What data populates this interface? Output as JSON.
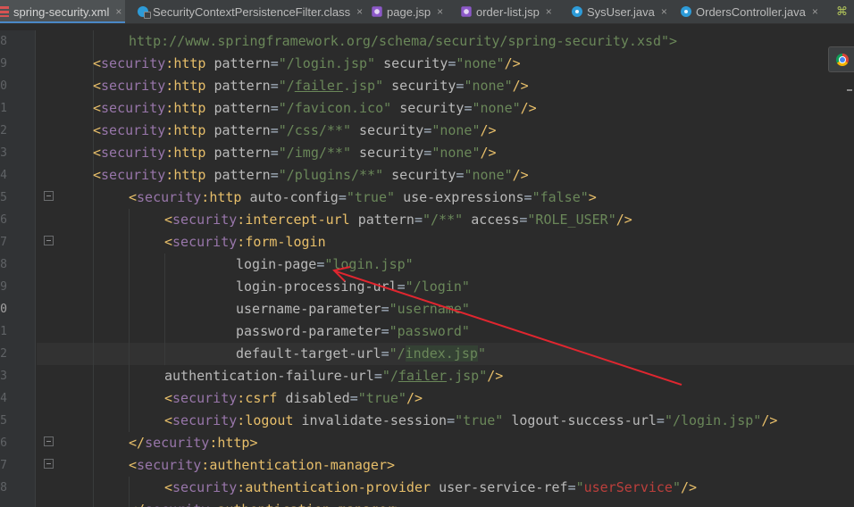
{
  "tabs": [
    {
      "label": "spring-security.xml",
      "icon": "xml-file-icon",
      "active": true
    },
    {
      "label": "SecurityContextPersistenceFilter.class",
      "icon": "class-file-icon",
      "active": false
    },
    {
      "label": "page.jsp",
      "icon": "jsp-file-icon",
      "active": false
    },
    {
      "label": "order-list.jsp",
      "icon": "jsp-file-icon",
      "active": false
    },
    {
      "label": "SysUser.java",
      "icon": "java-file-icon",
      "active": false
    },
    {
      "label": "OrdersController.java",
      "icon": "java-file-icon",
      "active": false
    }
  ],
  "tab_close_glyph": "×",
  "line_numbers": [
    "8",
    "9",
    "0",
    "1",
    "2",
    "3",
    "4",
    "5",
    "6",
    "7",
    "8",
    "9",
    "0",
    "1",
    "2",
    "3",
    "4",
    "5",
    "6",
    "7",
    "8"
  ],
  "current_line_index": 12,
  "code": {
    "l8_url": "http://www.springframework.org/schema/security/spring-security.xsd\">",
    "ns": "security",
    "http": "http",
    "pattern_attr": "pattern",
    "security_attr": "security",
    "none": "\"none\"",
    "patterns": [
      "\"/login.jsp\"",
      "\"/",
      "\"/favicon.ico\"",
      "\"/css/**\"",
      "\"/img/**\"",
      "\"/plugins/**\""
    ],
    "failer_name": "failer",
    "failer_ext": ".jsp\"",
    "auto_config_attr": "auto-config",
    "auto_config_val": "\"true\"",
    "use_expr_attr": "use-expressions",
    "use_expr_val": "\"false\"",
    "intercept_url": "intercept-url",
    "intercept_pattern": "\"/**\"",
    "access_attr": "access",
    "access_val": "\"ROLE_USER\"",
    "form_login": "form-login",
    "login_page_attr": "login-page",
    "login_page_val": "\"login.jsp\"",
    "login_proc_attr": "login-processing-url",
    "login_proc_val": "\"/login\"",
    "username_attr": "username-parameter",
    "username_val": "\"username\"",
    "password_attr": "password-parameter",
    "password_val": "\"password\"",
    "default_target_attr": "default-target-url",
    "default_target_q": "\"/",
    "default_target_file": "index.jsp",
    "default_target_end": "\"",
    "auth_failure_attr": "authentication-failure-url",
    "auth_failure_q": "\"/",
    "csrf": "csrf",
    "disabled_attr": "disabled",
    "disabled_val": "\"true\"",
    "logout": "logout",
    "invalidate_attr": "invalidate-session",
    "invalidate_val": "\"true\"",
    "logout_success_attr": "logout-success-url",
    "logout_success_val": "\"/login.jsp\"",
    "auth_manager": "authentication-manager",
    "auth_provider": "authentication-provider",
    "user_service_ref_attr": "user-service-ref",
    "user_service_ref_val": "userService"
  },
  "colors": {
    "background": "#2b2b2b",
    "tag": "#e8bf6a",
    "namespace": "#9876aa",
    "attribute": "#bababa",
    "value": "#6a8759",
    "error_ref": "#bc3f3c",
    "annotation_arrow": "#e0262f"
  }
}
